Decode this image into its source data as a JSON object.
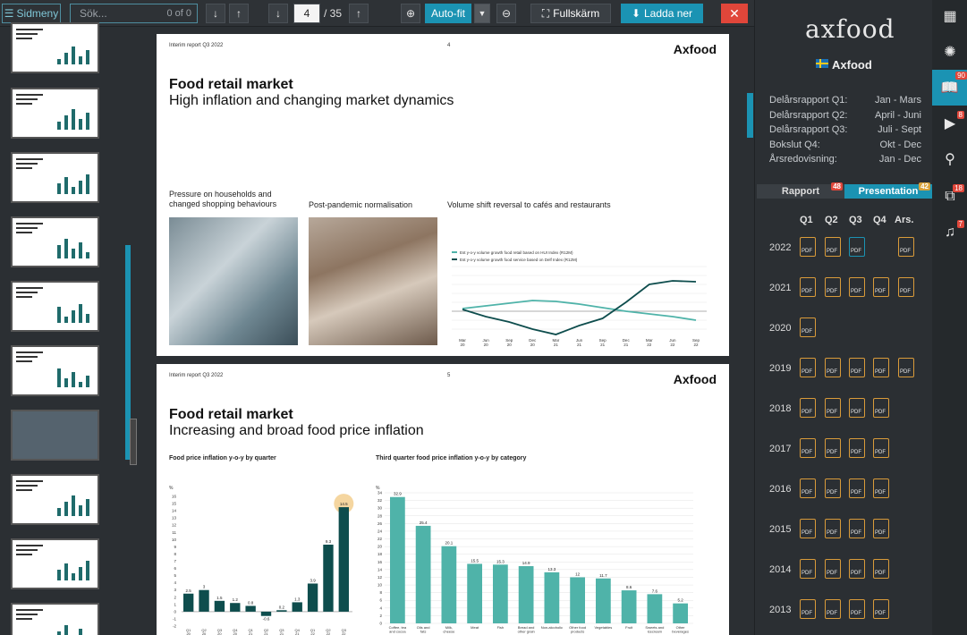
{
  "toolbar": {
    "sidmeny_label": "Sidmeny",
    "search_placeholder": "Sök...",
    "search_count": "0 of 0",
    "page_current": "4",
    "page_total": "/ 35",
    "autofit_label": "Auto-fit",
    "fullscreen_label": "Fullskärm",
    "download_label": "Ladda ner",
    "close_label": "✕"
  },
  "page1": {
    "header": "Interim report Q3 2022",
    "number": "4",
    "logo": "Axfood",
    "title": "Food retail market",
    "subtitle": "High inflation and changing market dynamics",
    "caption1": "Pressure on households and changed shopping behaviours",
    "caption2": "Post-pandemic normalisation",
    "caption3": "Volume shift reversal to cafés and restaurants",
    "legend1": "Est y-o-y volume growth food retail based on HUI Index (R12M)",
    "legend2": "Est y-o-y volume growth food service based on Delf Index (R12M)",
    "xticks": [
      "Mar 20",
      "Jun 20",
      "Sep 20",
      "Dec 20",
      "Mar 21",
      "Jun 21",
      "Sep 21",
      "Dec 21",
      "Mar 22",
      "Jun 22",
      "Sep 22"
    ]
  },
  "page2": {
    "header": "Interim report Q3 2022",
    "number": "5",
    "logo": "Axfood",
    "title": "Food retail market",
    "subtitle": "Increasing and broad food price inflation",
    "caption1": "Food price inflation y-o-y by quarter",
    "caption2": "Third quarter food price inflation y-o-y by category",
    "unit": "%"
  },
  "chart_data": [
    {
      "type": "line",
      "title": "Volume shift reversal to cafés and restaurants",
      "x": [
        "Mar 20",
        "Jun 20",
        "Sep 20",
        "Dec 20",
        "Mar 21",
        "Jun 21",
        "Sep 21",
        "Dec 21",
        "Mar 22",
        "Jun 22",
        "Sep 22"
      ],
      "series": [
        {
          "name": "Est y-o-y volume growth food retail based on HUI Index (R12M)",
          "values": [
            0.3,
            0.6,
            0.9,
            1.2,
            1.1,
            0.8,
            0.4,
            0.0,
            -0.3,
            -0.6,
            -1.0
          ]
        },
        {
          "name": "Est y-o-y volume growth food service based on Delf Index (R12M)",
          "values": [
            0.2,
            -0.6,
            -1.2,
            -2.0,
            -2.6,
            -1.6,
            -0.8,
            1.0,
            3.0,
            3.4,
            3.3
          ]
        }
      ]
    },
    {
      "type": "bar",
      "title": "Food price inflation y-o-y by quarter",
      "ylabel": "%",
      "ylim": [
        -2,
        16
      ],
      "categories": [
        "Q1 20",
        "Q2 20",
        "Q3 20",
        "Q4 20",
        "Q1 21",
        "Q2 21",
        "Q3 21",
        "Q4 21",
        "Q1 22",
        "Q2 22",
        "Q3 22"
      ],
      "values": [
        2.5,
        3.0,
        1.5,
        1.2,
        0.8,
        -0.6,
        0.2,
        1.3,
        3.9,
        9.3,
        14.5
      ]
    },
    {
      "type": "bar",
      "title": "Third quarter food price inflation y-o-y by category",
      "ylabel": "%",
      "ylim": [
        0,
        34
      ],
      "categories": [
        "Coffee, tea and cocoa",
        "Oils and fats",
        "Milk, cheese",
        "Meat",
        "Fish",
        "Bread and other grain",
        "Non-alcoholic",
        "Other food products",
        "Vegetables",
        "Fruit",
        "Sweets and icecream",
        "Other beverages"
      ],
      "values": [
        32.9,
        25.4,
        20.1,
        15.5,
        15.3,
        14.9,
        13.3,
        12.0,
        11.7,
        8.6,
        7.6,
        5.2
      ]
    }
  ],
  "panel": {
    "logo": "axfood",
    "company": "Axfood",
    "schedule": [
      {
        "label": "Delårsrapport Q1:",
        "value": "Jan - Mars"
      },
      {
        "label": "Delårsrapport Q2:",
        "value": "April - Juni"
      },
      {
        "label": "Delårsrapport Q3:",
        "value": "Juli - Sept"
      },
      {
        "label": "Bokslut Q4:",
        "value": "Okt - Dec"
      },
      {
        "label": "Årsredovisning:",
        "value": "Jan - Dec"
      }
    ],
    "tab_rapport": "Rapport",
    "tab_rapport_count": "48",
    "tab_presentation": "Presentation",
    "tab_presentation_count": "42",
    "columns": [
      "Q1",
      "Q2",
      "Q3",
      "Q4",
      "Ars."
    ],
    "years": [
      "2022",
      "2021",
      "2020",
      "2019",
      "2018",
      "2017",
      "2016",
      "2015",
      "2014",
      "2013"
    ],
    "pdf_label": "PDF"
  },
  "iconbar": {
    "badge_reader": "90",
    "badge_video": "8",
    "badge_share": "18",
    "badge_audio": "7"
  }
}
